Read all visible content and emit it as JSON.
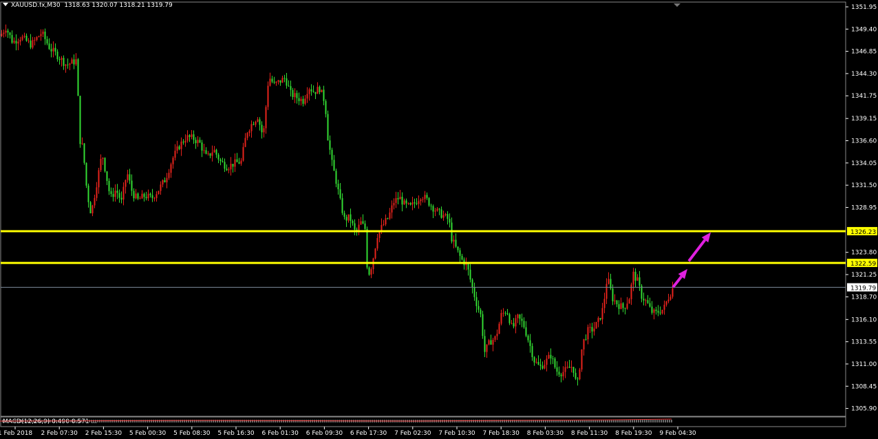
{
  "header": {
    "symbol": "XAUUSD.fx,M30",
    "ohlc": "1318.63 1320.07 1318.21 1319.79"
  },
  "macd": {
    "label": "MACD(12,26,9) 0.490 0.571 ..."
  },
  "colors": {
    "background": "#000000",
    "bull": "#e8231c",
    "bear": "#33dd33",
    "level": "#ffff00",
    "arrow": "#e020e0",
    "price_line": "#7a8797",
    "axis": "#ffffff"
  },
  "chart_data": {
    "type": "candlestick",
    "title": "XAUUSD.fx,M30",
    "ylim": [
      1305.0,
      1352.5
    ],
    "y_ticks": [
      "1351.95",
      "1349.40",
      "1346.85",
      "1344.30",
      "1341.75",
      "1339.15",
      "1336.60",
      "1334.05",
      "1331.50",
      "1328.95",
      "1323.80",
      "1321.25",
      "1318.70",
      "1316.10",
      "1313.55",
      "1311.00",
      "1308.45",
      "1305.90"
    ],
    "x_ticks": [
      "1 Feb 2018",
      "2 Feb 07:30",
      "2 Feb 15:30",
      "5 Feb 00:30",
      "5 Feb 08:30",
      "5 Feb 16:30",
      "6 Feb 01:30",
      "6 Feb 09:30",
      "6 Feb 17:30",
      "7 Feb 02:30",
      "7 Feb 10:30",
      "7 Feb 18:30",
      "8 Feb 03:30",
      "8 Feb 11:30",
      "8 Feb 19:30",
      "9 Feb 04:30"
    ],
    "levels": [
      {
        "label": "1326.23",
        "value": 1326.23
      },
      {
        "label": "1322.59",
        "value": 1322.59
      }
    ],
    "current_price": {
      "label": "1319.79",
      "value": 1319.79
    },
    "close_path": [
      [
        0,
        1348.6
      ],
      [
        8,
        1349.6
      ],
      [
        18,
        1347.9
      ],
      [
        30,
        1348.5
      ],
      [
        45,
        1347.6
      ],
      [
        60,
        1349.0
      ],
      [
        72,
        1347.2
      ],
      [
        84,
        1346.3
      ],
      [
        96,
        1345.3
      ],
      [
        108,
        1345.7
      ],
      [
        112,
        1345.9
      ],
      [
        114,
        1337.0
      ],
      [
        120,
        1335.8
      ],
      [
        126,
        1330.6
      ],
      [
        132,
        1328.2
      ],
      [
        140,
        1331.7
      ],
      [
        148,
        1335.2
      ],
      [
        154,
        1332.6
      ],
      [
        160,
        1330.0
      ],
      [
        168,
        1331.0
      ],
      [
        176,
        1329.6
      ],
      [
        184,
        1333.0
      ],
      [
        192,
        1330.6
      ],
      [
        200,
        1329.8
      ],
      [
        210,
        1330.3
      ],
      [
        220,
        1330.0
      ],
      [
        230,
        1331.0
      ],
      [
        240,
        1332.2
      ],
      [
        250,
        1334.5
      ],
      [
        260,
        1336.0
      ],
      [
        270,
        1337.0
      ],
      [
        280,
        1336.9
      ],
      [
        290,
        1336.3
      ],
      [
        300,
        1334.6
      ],
      [
        310,
        1335.6
      ],
      [
        320,
        1334.2
      ],
      [
        330,
        1333.6
      ],
      [
        340,
        1334.0
      ],
      [
        350,
        1334.2
      ],
      [
        358,
        1337.6
      ],
      [
        366,
        1338.6
      ],
      [
        374,
        1339.4
      ],
      [
        382,
        1337.0
      ],
      [
        390,
        1344.0
      ],
      [
        398,
        1343.0
      ],
      [
        406,
        1343.4
      ],
      [
        414,
        1343.8
      ],
      [
        422,
        1342.0
      ],
      [
        430,
        1341.6
      ],
      [
        440,
        1341.2
      ],
      [
        448,
        1342.8
      ],
      [
        456,
        1342.2
      ],
      [
        464,
        1342.6
      ],
      [
        472,
        1341.0
      ],
      [
        476,
        1337.0
      ],
      [
        482,
        1334.0
      ],
      [
        488,
        1332.0
      ],
      [
        494,
        1329.6
      ],
      [
        500,
        1327.6
      ],
      [
        508,
        1327.8
      ],
      [
        516,
        1326.0
      ],
      [
        524,
        1327.2
      ],
      [
        530,
        1326.5
      ],
      [
        534,
        1321.0
      ],
      [
        540,
        1322.4
      ],
      [
        548,
        1325.8
      ],
      [
        556,
        1326.9
      ],
      [
        564,
        1327.8
      ],
      [
        572,
        1329.6
      ],
      [
        580,
        1330.1
      ],
      [
        588,
        1329.2
      ],
      [
        596,
        1329.0
      ],
      [
        604,
        1329.6
      ],
      [
        612,
        1330.4
      ],
      [
        620,
        1329.8
      ],
      [
        628,
        1329.0
      ],
      [
        636,
        1328.4
      ],
      [
        644,
        1328.0
      ],
      [
        652,
        1327.5
      ],
      [
        656,
        1325.4
      ],
      [
        662,
        1324.3
      ],
      [
        670,
        1323.0
      ],
      [
        678,
        1322.3
      ],
      [
        686,
        1319.7
      ],
      [
        692,
        1318.0
      ],
      [
        698,
        1316.6
      ],
      [
        704,
        1312.4
      ],
      [
        712,
        1313.6
      ],
      [
        720,
        1314.0
      ],
      [
        728,
        1316.6
      ],
      [
        736,
        1317.2
      ],
      [
        744,
        1315.0
      ],
      [
        752,
        1316.3
      ],
      [
        760,
        1315.6
      ],
      [
        768,
        1313.6
      ],
      [
        776,
        1311.4
      ],
      [
        784,
        1310.6
      ],
      [
        792,
        1311.2
      ],
      [
        800,
        1312.0
      ],
      [
        808,
        1310.2
      ],
      [
        816,
        1310.0
      ],
      [
        824,
        1310.4
      ],
      [
        832,
        1310.8
      ],
      [
        838,
        1308.2
      ],
      [
        846,
        1313.3
      ],
      [
        854,
        1314.8
      ],
      [
        862,
        1315.0
      ],
      [
        870,
        1316.0
      ],
      [
        876,
        1317.4
      ],
      [
        882,
        1321.0
      ],
      [
        890,
        1318.5
      ],
      [
        898,
        1317.8
      ],
      [
        906,
        1317.4
      ],
      [
        914,
        1318.6
      ],
      [
        920,
        1321.3
      ],
      [
        926,
        1320.5
      ],
      [
        932,
        1318.8
      ],
      [
        940,
        1318.0
      ],
      [
        946,
        1317.0
      ],
      [
        952,
        1316.8
      ],
      [
        958,
        1317.1
      ],
      [
        964,
        1317.3
      ],
      [
        970,
        1318.5
      ],
      [
        978,
        1319.79
      ]
    ],
    "projection_arrows": [
      {
        "from": [
          978,
          1319.79
        ],
        "to": [
          999,
          1321.9
        ]
      },
      {
        "from": [
          1001,
          1322.8
        ],
        "to": [
          1033,
          1326.1
        ]
      }
    ]
  }
}
